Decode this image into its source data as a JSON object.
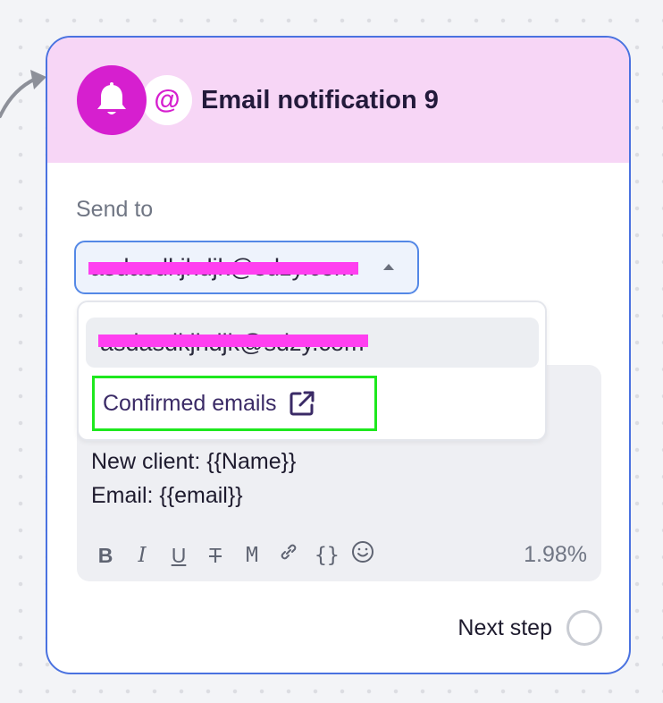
{
  "node": {
    "title": "Email notification 9",
    "bell_icon": "bell-icon",
    "at_symbol": "@"
  },
  "send_to": {
    "label": "Send to",
    "selected_value": "asdasdkjhdjk@sdzy.com",
    "redacted": true
  },
  "dropdown": {
    "options": [
      {
        "label": "asdasdkjhdjk@sdzy.com",
        "redacted": true
      }
    ],
    "link_label": "Confirmed emails",
    "link_icon": "external-link-icon"
  },
  "editor": {
    "lines": [
      "New client: {{Name}}",
      "Email: {{email}}"
    ],
    "toolbar": [
      {
        "name": "bold-button",
        "glyph": "B"
      },
      {
        "name": "italic-button",
        "glyph": "I"
      },
      {
        "name": "underline-button",
        "glyph": "U"
      },
      {
        "name": "strikethrough-button",
        "glyph": "T"
      },
      {
        "name": "monospace-button",
        "glyph": "M"
      },
      {
        "name": "link-button",
        "glyph": "🔗"
      },
      {
        "name": "variable-button",
        "glyph": "{}"
      },
      {
        "name": "emoji-button",
        "glyph": "☺"
      }
    ],
    "char_count": "1.98%"
  },
  "footer": {
    "next_step_label": "Next step"
  },
  "colors": {
    "accent": "#d61fcf",
    "header_bg": "#f7d6f6",
    "border": "#4a72e0",
    "highlight": "#1ee81e",
    "redaction": "#ff3ff0"
  }
}
